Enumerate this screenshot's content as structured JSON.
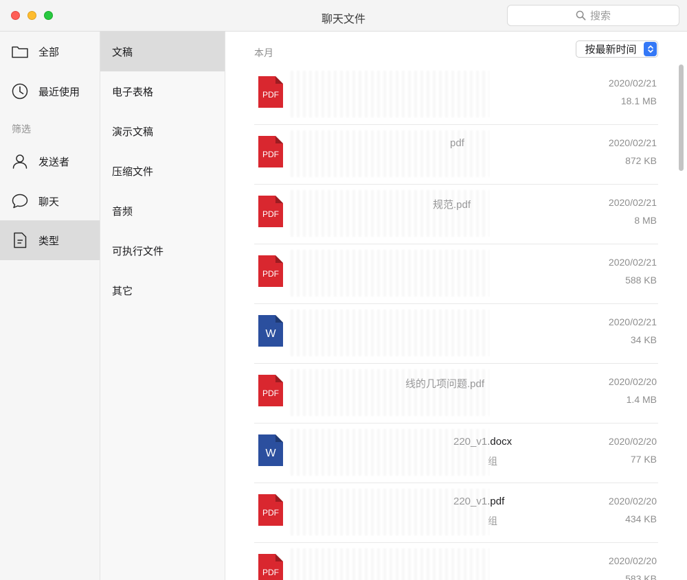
{
  "window": {
    "title": "聊天文件"
  },
  "search": {
    "placeholder": "搜索"
  },
  "sidebar1": {
    "items": [
      {
        "label": "全部",
        "icon": "folder-icon"
      },
      {
        "label": "最近使用",
        "icon": "clock-icon"
      }
    ],
    "section_label": "筛选",
    "filters": [
      {
        "label": "发送者",
        "icon": "person-icon"
      },
      {
        "label": "聊天",
        "icon": "chat-bubble-icon"
      },
      {
        "label": "类型",
        "icon": "document-icon",
        "active": true
      }
    ]
  },
  "sidebar2": {
    "items": [
      {
        "label": "文稿",
        "active": true
      },
      {
        "label": "电子表格"
      },
      {
        "label": "演示文稿"
      },
      {
        "label": "压缩文件"
      },
      {
        "label": "音频"
      },
      {
        "label": "可执行文件"
      },
      {
        "label": "其它"
      }
    ]
  },
  "main": {
    "section_label": "本月",
    "sort_label": "按最新时间",
    "files": [
      {
        "type": "PDF",
        "name": "",
        "subtitle": "",
        "date": "2020/02/21",
        "size": "18.1 MB"
      },
      {
        "type": "PDF",
        "name": "pdf",
        "subtitle": "",
        "date": "2020/02/21",
        "size": "872 KB"
      },
      {
        "type": "PDF",
        "name": "规范.pdf",
        "subtitle": "",
        "date": "2020/02/21",
        "size": "8 MB"
      },
      {
        "type": "PDF",
        "name": "",
        "subtitle": "",
        "date": "2020/02/21",
        "size": "588 KB"
      },
      {
        "type": "W",
        "name": "",
        "subtitle": "",
        "date": "2020/02/21",
        "size": "34 KB"
      },
      {
        "type": "PDF",
        "name": "线的几项问题.pdf",
        "subtitle": "",
        "date": "2020/02/20",
        "size": "1.4 MB"
      },
      {
        "type": "W",
        "name": "220_v1.docx",
        "subtitle": "组",
        "date": "2020/02/20",
        "size": "77 KB"
      },
      {
        "type": "PDF",
        "name": "220_v1.pdf",
        "subtitle": "组",
        "date": "2020/02/20",
        "size": "434 KB"
      },
      {
        "type": "PDF",
        "name": "",
        "subtitle": "",
        "date": "2020/02/20",
        "size": "583 KB"
      }
    ]
  },
  "colors": {
    "pdf": "#d9272f",
    "word": "#2b4f9e",
    "accent": "#3478f6"
  }
}
